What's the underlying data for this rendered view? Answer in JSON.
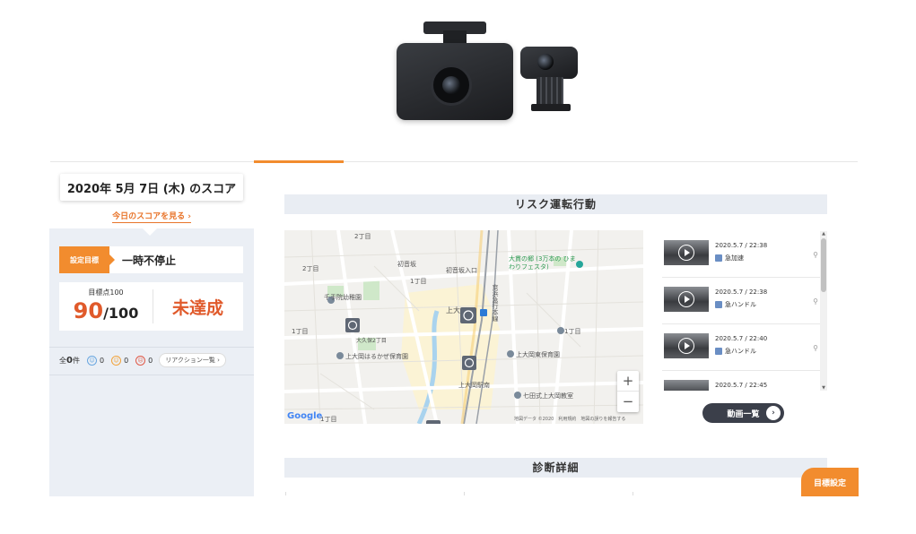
{
  "product": {
    "alt": "dashcam-product"
  },
  "date_selector": {
    "text": "2020年 5月 7日 (木) のスコア",
    "caret": "▾"
  },
  "today_link": "今日のスコアを見る ›",
  "goal": {
    "tag": "設定目標",
    "text": "一時不停止"
  },
  "score": {
    "target_label": "目標点100",
    "value": "90",
    "denominator": "/100",
    "status": "未達成"
  },
  "reactions": {
    "total_prefix": "全",
    "total_count": "0",
    "total_suffix": "件",
    "blue_count": "0",
    "orange_count": "0",
    "red_count": "0",
    "list_button": "リアクション一覧 ›"
  },
  "risk_section": {
    "title": "リスク運転行動"
  },
  "map": {
    "labels": {
      "chome_top": "2丁目",
      "chome_left": "1丁目",
      "chome_left2": "2丁目",
      "chome_mid": "1丁目",
      "chome_right": "1丁目",
      "chome_bottom": "1丁目",
      "kindergarten": "千手院幼稚園",
      "nursery": "上大岡はるかぜ保育園",
      "nursery2": "上大岡東保育園",
      "church": "七田式上大岡教室",
      "park": "大貫の郷 (3万本の ひまわりフェスタ)",
      "entrance": "初音坂入口",
      "station": "上大岡駅南",
      "road": "京浜急行本線",
      "bus": "大久保2丁目",
      "teacher": "初音坂",
      "kamiooka": "上大"
    },
    "footer": "地図データ ©2020　利用規約　地図の誤りを報告する",
    "google": "Google"
  },
  "videos": [
    {
      "date": "2020.5.7 / 22:38",
      "type": "急加速"
    },
    {
      "date": "2020.5.7 / 22:38",
      "type": "急ハンドル"
    },
    {
      "date": "2020.5.7 / 22:40",
      "type": "急ハンドル"
    },
    {
      "date": "2020.5.7 / 22:45",
      "type": ""
    }
  ],
  "video_list_button": "動画一覧",
  "diagnosis_section": {
    "title": "診断詳細"
  },
  "goal_setting_button": "目標設定",
  "colors": {
    "accent": "#f28c2e",
    "score_red": "#e05a2b",
    "panel_bg": "#ebeff5",
    "button_dark": "#3b3f4a"
  }
}
